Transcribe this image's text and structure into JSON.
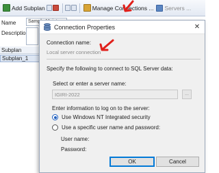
{
  "toolbar": {
    "add_subplan": "Add Subplan",
    "manage_connections": "Manage Connections ...",
    "servers": "Servers ..."
  },
  "designer": {
    "name_label": "Name",
    "name_value": "Sample Maintenance Plan",
    "description_label": "Description",
    "grid_header": "Subplan",
    "grid_row": "Subplan_1"
  },
  "dialog": {
    "title": "Connection Properties",
    "connection_name_label": "Connection name:",
    "connection_name_value": "Local server connection",
    "intro": "Specify the following to connect to SQL Server data:",
    "server_label": "Select or enter a server name:",
    "server_value": "IGIRI-2022",
    "browse_label": "...",
    "logon_label": "Enter information to log on to the server:",
    "auth_options": [
      {
        "label": "Use Windows NT Integrated security",
        "checked": true
      },
      {
        "label": "Use a specific user name and password:",
        "checked": false
      }
    ],
    "username_label": "User name:",
    "password_label": "Password:",
    "ok_label": "OK",
    "cancel_label": "Cancel"
  },
  "colors": {
    "annotation_arrow": "#e0201b",
    "focus_blue": "#0078d7"
  },
  "icons": {
    "add_subplan": "add-subplan-icon",
    "manage_connections": "manage-connections-icon",
    "servers": "servers-icon",
    "dialog": "database-icon",
    "close": "close-icon"
  }
}
